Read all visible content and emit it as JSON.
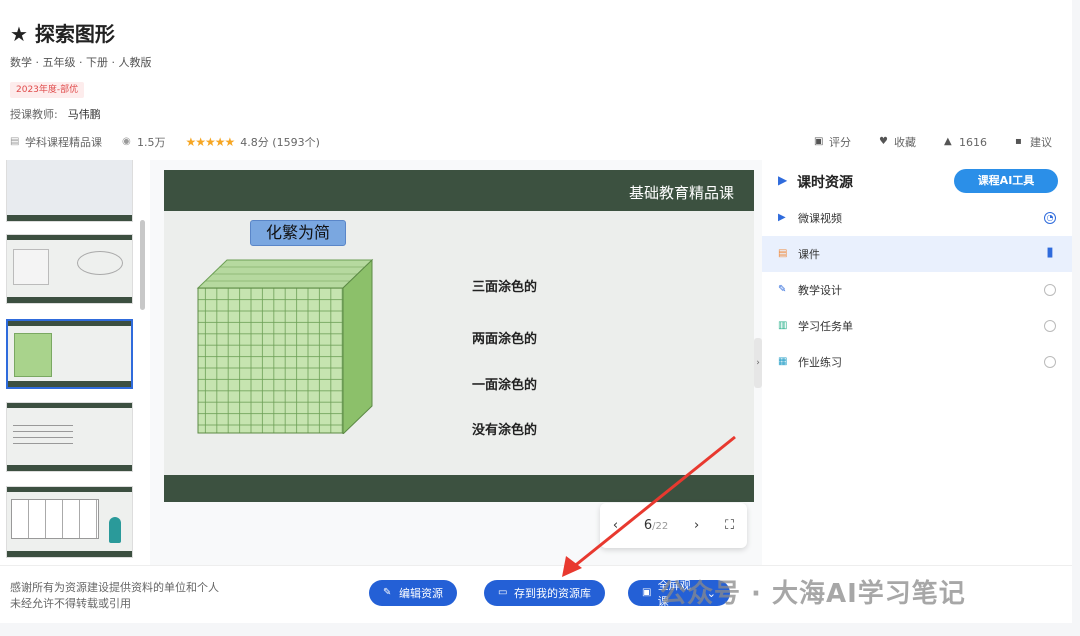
{
  "course": {
    "title": "★ 探索图形",
    "subtitle": "数学 · 五年级 · 下册 · 人教版",
    "badge": "2023年度-部优",
    "teacher_label": "授课教师:",
    "teacher_name": "马伟鹏"
  },
  "meta": {
    "category": "学科课程精品课",
    "views": "1.5万",
    "stars": "★★★★★",
    "rating": "4.8分",
    "rating_count": "(1593个)"
  },
  "actions": {
    "rate": "评分",
    "favorite": "收藏",
    "likes": "1616",
    "suggest": "建议"
  },
  "slide": {
    "brand": "基础教育精品课",
    "title": "化繁为简",
    "labels": [
      "三面涂色的",
      "两面涂色的",
      "一面涂色的",
      "没有涂色的"
    ]
  },
  "pager": {
    "current": "6",
    "total": "/22"
  },
  "panel": {
    "title": "课时资源",
    "ai_button": "课程AI工具",
    "items": [
      {
        "label": "微课视频",
        "icon": "▶",
        "color": "#2f6bdc"
      },
      {
        "label": "课件",
        "icon": "▤",
        "color": "#f08a3c"
      },
      {
        "label": "教学设计",
        "icon": "✎",
        "color": "#2f6bdc"
      },
      {
        "label": "学习任务单",
        "icon": "▥",
        "color": "#29b18b"
      },
      {
        "label": "作业练习",
        "icon": "▦",
        "color": "#29a0c8"
      }
    ]
  },
  "footer": {
    "note1": "感谢所有为资源建设提供资料的单位和个人",
    "note2": "未经允许不得转载或引用",
    "edit": "编辑资源",
    "save": "存到我的资源库",
    "fullscreen": "全屏观课"
  },
  "watermark": "公众号 · 大海AI学习笔记"
}
